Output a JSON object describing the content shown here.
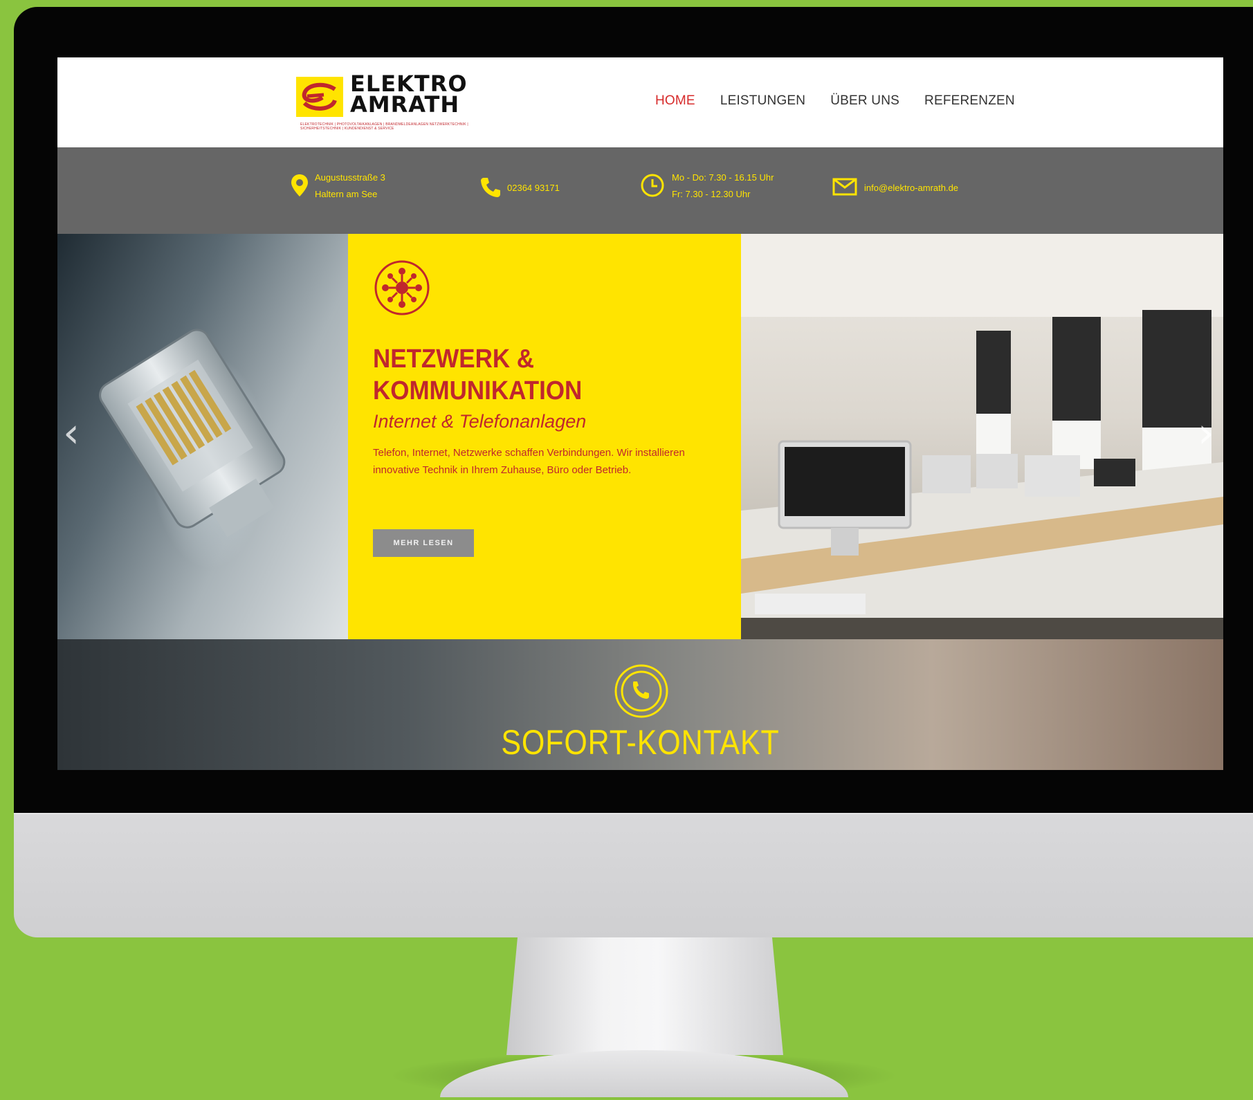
{
  "brand": {
    "name_line1": "ELEKTRO",
    "name_line2": "AMRATH",
    "tagline": "ELEKTROTECHNIK | PHOTOVOLTAIKANLAGEN | BRANDMELDEANLAGEN NETZWERKTECHNIK | SICHERHEITSTECHNIK | KUNDENDIENST & SERVICE"
  },
  "nav": {
    "items": [
      {
        "label": "HOME",
        "active": true
      },
      {
        "label": "LEISTUNGEN",
        "active": false
      },
      {
        "label": "ÜBER UNS",
        "active": false
      },
      {
        "label": "REFERENZEN",
        "active": false
      }
    ]
  },
  "info": {
    "address_line1": "Augustusstraße 3",
    "address_line2": "Haltern am See",
    "phone": "02364 93171",
    "hours_line1": "Mo - Do: 7.30 - 16.15 Uhr",
    "hours_line2": "Fr: 7.30 - 12.30 Uhr",
    "email": "info@elektro-amrath.de"
  },
  "hero": {
    "title_line1": "NETZWERK &",
    "title_line2": "KOMMUNIKATION",
    "subtitle": "Internet & Telefonanlagen",
    "text": "Telefon, Internet, Netzwerke schaffen Verbindungen. Wir installieren innovative Technik in Ihrem Zuhause, Büro oder Betrieb.",
    "button_label": "MEHR LESEN",
    "arrow_prev": "‹",
    "arrow_next": "›"
  },
  "contact": {
    "title": "SOFORT-KONTAKT"
  },
  "colors": {
    "background": "#8ac43f",
    "brand_yellow": "#ffe400",
    "brand_red": "#c0272d",
    "info_bar": "#666666",
    "button_grey": "#8c8c8c"
  },
  "icons": {
    "address": "map-pin-icon",
    "phone": "phone-icon",
    "hours": "clock-icon",
    "email": "envelope-icon",
    "hero": "network-icon",
    "contact": "phone-circle-icon"
  }
}
